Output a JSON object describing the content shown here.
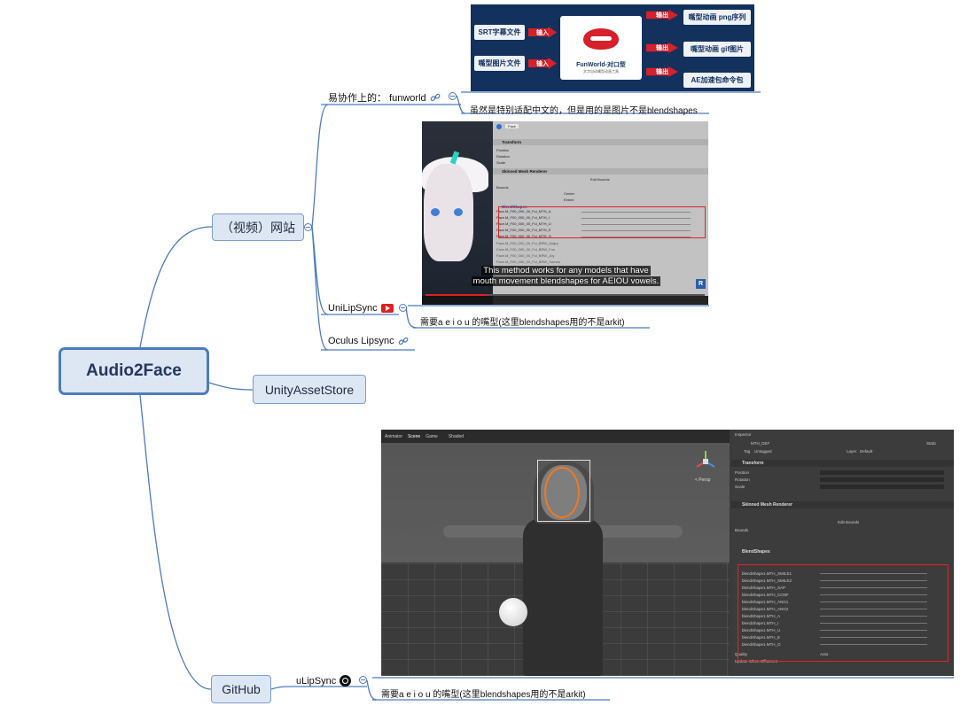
{
  "root": {
    "label": "Audio2Face"
  },
  "topics": {
    "video": {
      "label": "（视频）网站"
    },
    "store": {
      "label": "UnityAssetStore"
    },
    "github": {
      "label": "GitHub"
    }
  },
  "subtopics": {
    "funworld": {
      "label": "易协作上的：  funworld",
      "note": "虽然是特别适配中文的，但是用的是图片不是blendshapes"
    },
    "unilipsync": {
      "label": "UniLipSync",
      "note": "需要a e i o u 的嘴型(这里blendshapes用的不是arkit)"
    },
    "oculus": {
      "label": "Oculus Lipsync"
    },
    "ulipsync": {
      "label": "uLipSync",
      "note": "需要a e i o u 的嘴型(这里blendshapes用的不是arkit)"
    }
  },
  "funworld_image": {
    "inputs": [
      "SRT字幕文件",
      "嘴型图片文件"
    ],
    "input_arrow": "输入",
    "output_arrow": "输出",
    "outputs": [
      "嘴型动画 png序列",
      "嘴型动画 gif图片",
      "AE加速包命令包"
    ],
    "brand_title": "FunWorld-对口型",
    "brand_subtitle": "文字自动嘴型动画工具"
  },
  "youtube_image": {
    "caption_line1": "This method works for any models that have",
    "caption_line2": "mouth movement blendshapes for AEIOU vowels.",
    "panel_name": "Face",
    "transform_header": "Transform",
    "transform_rows": [
      "Position",
      "Rotation",
      "Scale"
    ],
    "renderer_header": "Skinned Mesh Renderer",
    "edit_bounds": "Edit Bounds",
    "bounds_label": "Bounds",
    "center_label": "Center",
    "extent_label": "Extent",
    "blendshapes_header": "BlendShapes",
    "blendshapes": [
      "Face.M_F00_000_00_Fcl_MTH_A",
      "Face.M_F00_000_00_Fcl_MTH_I",
      "Face.M_F00_000_00_Fcl_MTH_U",
      "Face.M_F00_000_00_Fcl_MTH_E",
      "Face.M_F00_000_00_Fcl_MTH_O",
      "Face.M_F00_000_00_Fcl_BRW_Angry",
      "Face.M_F00_000_00_Fcl_BRW_Fun",
      "Face.M_F00_000_00_Fcl_BRW_Joy",
      "Face.M_F00_000_00_Fcl_BRW_Sorrow"
    ],
    "r_badge": "R"
  },
  "unity_image": {
    "tabs": [
      "Animator",
      "Scene",
      "Game"
    ],
    "shading": "Shaded",
    "persp_label": "< Persp",
    "inspector_tab": "Inspector",
    "object_name": "MTH_DEF",
    "static_label": "Static",
    "tag_label": "Tag",
    "tag_value": "Untagged",
    "layer_label": "Layer",
    "layer_value": "Default",
    "transform_header": "Transform",
    "transform_rows": [
      "Position",
      "Rotation",
      "Scale"
    ],
    "renderer_header": "Skinned Mesh Renderer",
    "edit_bounds": "Edit Bounds",
    "bounds_label": "Bounds",
    "blendshapes_header": "BlendShapes",
    "blendshapes": [
      "blendShape1.MTH_SMILE1",
      "blendShape1.MTH_SMILE2",
      "blendShape1.MTH_SAP",
      "blendShape1.MTH_CONF",
      "blendShape1.MTH_ANG1",
      "blendShape1.MTH_ANG2",
      "blendShape1.MTH_A",
      "blendShape1.MTH_I",
      "blendShape1.MTH_U",
      "blendShape1.MTH_E",
      "blendShape1.MTH_O"
    ],
    "quality_label": "Quality",
    "quality_value": "Auto",
    "update_label": "Update When Offscreen"
  },
  "colors": {
    "branch": "#4d7bbf",
    "root_fill": "#dde6f3",
    "highlight": "#e02525",
    "funworld_bg": "#12315c"
  }
}
